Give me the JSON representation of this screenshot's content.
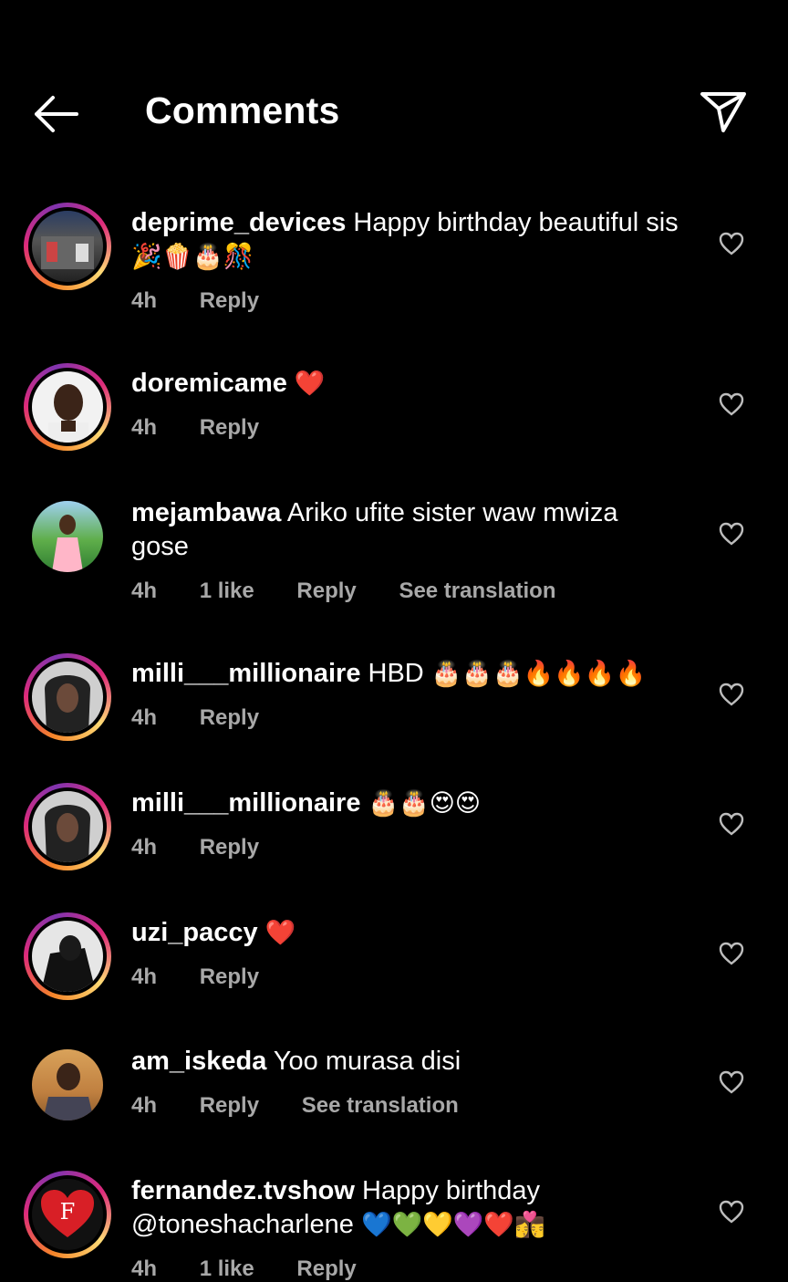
{
  "header": {
    "title": "Comments",
    "back_icon": "arrow-left-icon",
    "share_icon": "paper-plane-icon"
  },
  "comments": [
    {
      "username": "deprime_devices",
      "text": "Happy birthday beautiful sis",
      "emojis": "🎉🍿🎂🎊",
      "time": "4h",
      "likes": "",
      "reply": "Reply",
      "translate": ""
    },
    {
      "username": "doremicame",
      "text": "",
      "emojis": "❤️",
      "time": "4h",
      "likes": "",
      "reply": "Reply",
      "translate": ""
    },
    {
      "username": "mejambawa",
      "text": "Ariko ufite sister waw mwiza gose",
      "emojis": "",
      "time": "4h",
      "likes": "1 like",
      "reply": "Reply",
      "translate": "See translation"
    },
    {
      "username": "milli___millionaire",
      "text": "HBD",
      "emojis": "🎂🎂🎂🔥🔥🔥🔥",
      "time": "4h",
      "likes": "",
      "reply": "Reply",
      "translate": ""
    },
    {
      "username": "milli___millionaire",
      "text": "",
      "emojis": "🎂🎂😍😍",
      "time": "4h",
      "likes": "",
      "reply": "Reply",
      "translate": ""
    },
    {
      "username": "uzi_paccy",
      "text": "",
      "emojis": "❤️",
      "time": "4h",
      "likes": "",
      "reply": "Reply",
      "translate": ""
    },
    {
      "username": "am_iskeda",
      "text": "Yoo murasa disi",
      "emojis": "",
      "time": "4h",
      "likes": "",
      "reply": "Reply",
      "translate": "See translation"
    },
    {
      "username": "fernandez.tvshow",
      "text": "Happy birthday @toneshacharlene",
      "emojis": "💙💚💛💜❤️👩‍❤️‍💋‍👨",
      "time": "4h",
      "likes": "1 like",
      "reply": "Reply",
      "translate": ""
    }
  ],
  "avatar_logo_text": "F",
  "colors": {
    "background": "#000000",
    "text": "#ffffff",
    "meta": "#a8a8a8"
  }
}
